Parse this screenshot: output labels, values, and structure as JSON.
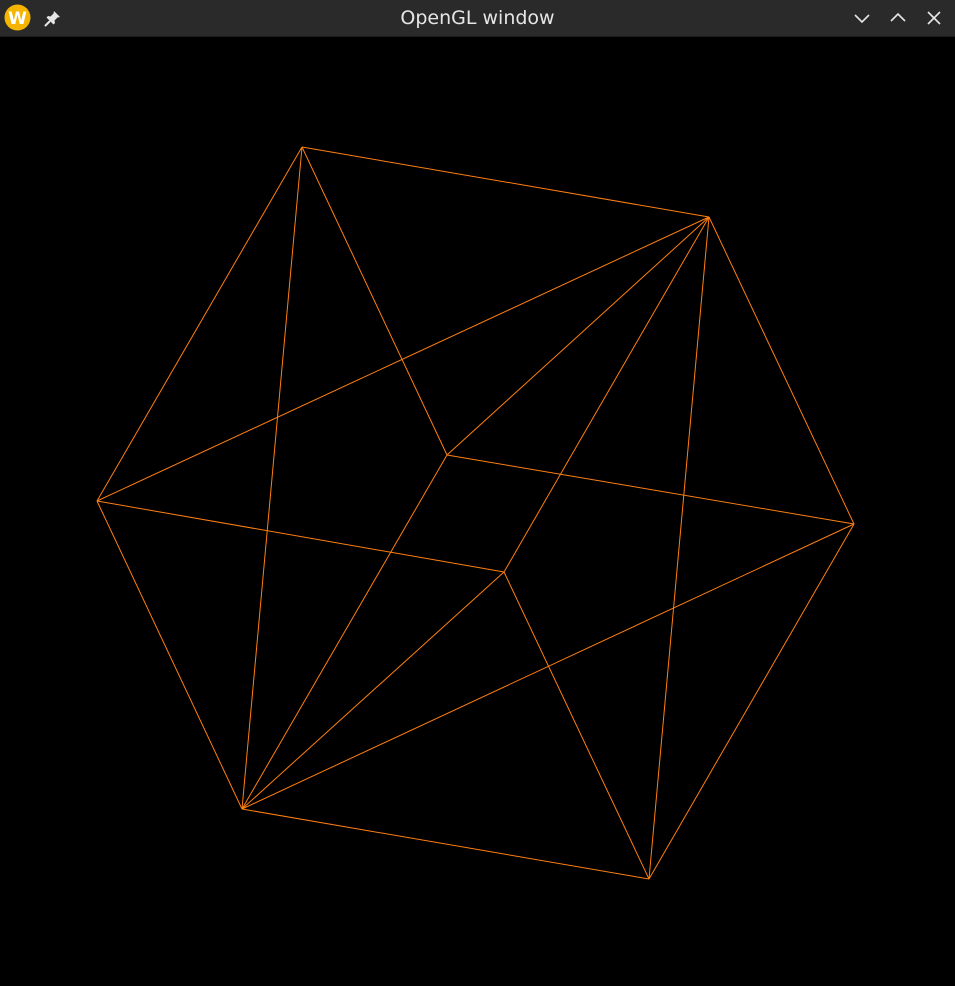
{
  "window": {
    "title": "OpenGL window",
    "app_icon": "kde-w-logo-icon",
    "buttons": [
      {
        "name": "keep-above-pin",
        "icon": "pin-icon"
      },
      {
        "name": "minimize",
        "icon": "chevron-down-icon"
      },
      {
        "name": "maximize",
        "icon": "chevron-up-icon"
      },
      {
        "name": "close",
        "icon": "close-icon"
      }
    ]
  },
  "scene": {
    "background": "#000000",
    "line_color": "#ff7f10",
    "shape": "wireframe cube with face diagonals"
  }
}
